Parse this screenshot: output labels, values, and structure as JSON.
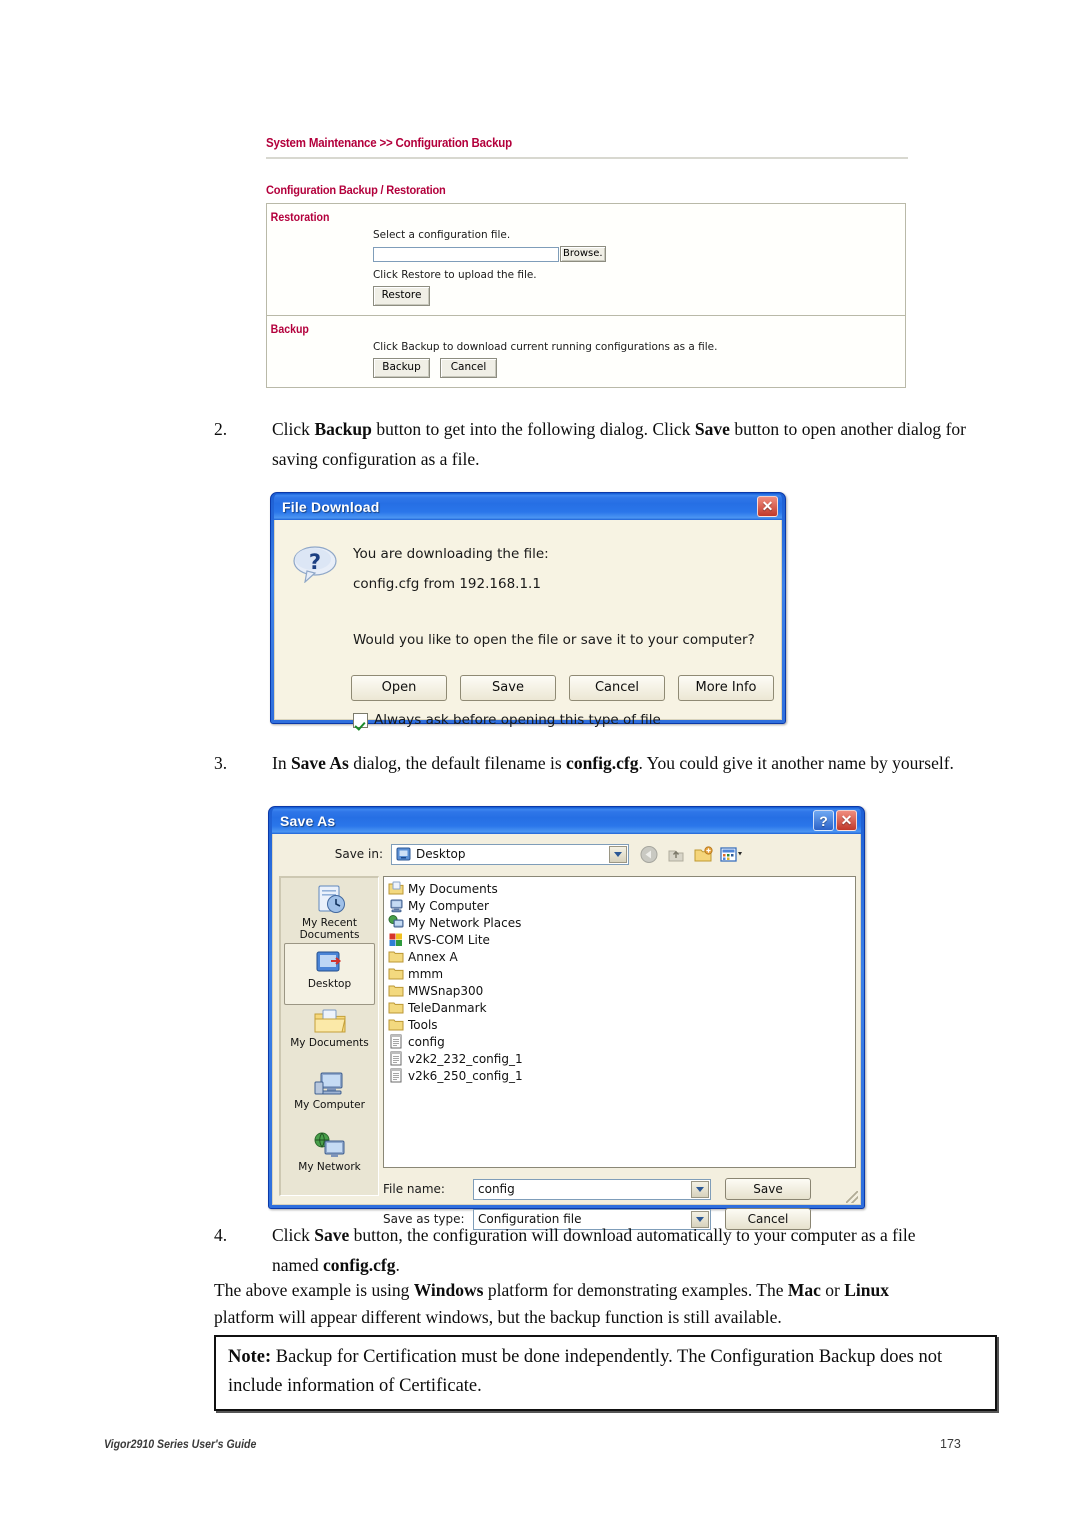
{
  "router_panel": {
    "breadcrumb": "System Maintenance >> Configuration Backup",
    "section_title": "Configuration Backup / Restoration",
    "restoration": {
      "label": "Restoration",
      "select_text": "Select a configuration file.",
      "file_input_value": "",
      "browse_label": "Browse.",
      "restore_hint": "Click Restore to upload the file.",
      "restore_label": "Restore"
    },
    "backup": {
      "label": "Backup",
      "hint": "Click Backup to download current running configurations as a file.",
      "backup_label": "Backup",
      "cancel_label": "Cancel"
    },
    "accent_color": "#b3003c"
  },
  "steps": {
    "step2": {
      "number": "2.",
      "text_parts": [
        {
          "t": "Click ",
          "b": false
        },
        {
          "t": "Backup",
          "b": true
        },
        {
          "t": " button to get into the following dialog. Click ",
          "b": false
        },
        {
          "t": "Save",
          "b": true
        },
        {
          "t": " button to open another dialog for saving configuration as a file.",
          "b": false
        }
      ]
    },
    "step3": {
      "number": "3.",
      "text_parts": [
        {
          "t": "In ",
          "b": false
        },
        {
          "t": "Save As",
          "b": true
        },
        {
          "t": " dialog, the default filename is ",
          "b": false
        },
        {
          "t": "config.cfg",
          "b": true
        },
        {
          "t": ". You could give it another name by yourself.",
          "b": false
        }
      ]
    },
    "step4": {
      "number": "4.",
      "text_parts": [
        {
          "t": "Click ",
          "b": false
        },
        {
          "t": "Save",
          "b": true
        },
        {
          "t": " button, the configuration will download automatically to your computer as a file named ",
          "b": false
        },
        {
          "t": "config.cfg",
          "b": true
        },
        {
          "t": ".",
          "b": false
        }
      ]
    }
  },
  "platform_note": {
    "text_parts": [
      {
        "t": "The above example is using ",
        "b": false
      },
      {
        "t": "Windows",
        "b": true
      },
      {
        "t": " platform for demonstrating examples. The ",
        "b": false
      },
      {
        "t": "Mac",
        "b": true
      },
      {
        "t": " or ",
        "b": false
      },
      {
        "t": "Linux",
        "b": true
      },
      {
        "t": " platform will appear different windows, but the backup function is still available.",
        "b": false
      }
    ]
  },
  "note_box": {
    "text_parts": [
      {
        "t": "Note:",
        "b": true
      },
      {
        "t": " Backup for Certification must be done independently. The Configuration Backup does not include information of Certificate.",
        "b": false
      }
    ]
  },
  "footer": {
    "left": "Vigor2910 Series User's Guide",
    "page": "173"
  },
  "file_download_dialog": {
    "title": "File Download",
    "close_label": "✕",
    "icon": "question-bubble-icon",
    "line1": "You are downloading the file:",
    "line2": "config.cfg from 192.168.1.1",
    "line3": "Would you like to open the file or save it to your computer?",
    "buttons": [
      "Open",
      "Save",
      "Cancel",
      "More Info"
    ],
    "checkbox_label": "Always ask before opening this type of file",
    "checkbox_checked": true
  },
  "save_as_dialog": {
    "title": "Save As",
    "help_label": "?",
    "close_label": "✕",
    "save_in_label": "Save in:",
    "save_in_value": "Desktop",
    "toolbar_icons": [
      "back-icon",
      "up-one-level-icon",
      "new-folder-icon",
      "views-icon"
    ],
    "places": [
      {
        "label": "My Recent\nDocuments",
        "icon": "recent-documents-icon",
        "selected": false
      },
      {
        "label": "Desktop",
        "icon": "desktop-icon",
        "selected": true
      },
      {
        "label": "My Documents",
        "icon": "my-documents-icon",
        "selected": false
      },
      {
        "label": "My Computer",
        "icon": "my-computer-icon",
        "selected": false
      },
      {
        "label": "My Network",
        "icon": "my-network-icon",
        "selected": false
      }
    ],
    "files": [
      {
        "name": "My Documents",
        "icon": "documents-folder-icon"
      },
      {
        "name": "My Computer",
        "icon": "my-computer-icon"
      },
      {
        "name": "My Network Places",
        "icon": "network-places-icon"
      },
      {
        "name": "RVS-COM Lite",
        "icon": "app-icon"
      },
      {
        "name": "Annex A",
        "icon": "folder-icon"
      },
      {
        "name": "mmm",
        "icon": "folder-icon"
      },
      {
        "name": "MWSnap300",
        "icon": "folder-icon"
      },
      {
        "name": "TeleDanmark",
        "icon": "folder-icon"
      },
      {
        "name": "Tools",
        "icon": "folder-icon"
      },
      {
        "name": "config",
        "icon": "file-icon"
      },
      {
        "name": "v2k2_232_config_1",
        "icon": "file-icon"
      },
      {
        "name": "v2k6_250_config_1",
        "icon": "file-icon"
      }
    ],
    "file_name_label": "File name:",
    "file_name_value": "config",
    "save_as_type_label": "Save as type:",
    "save_as_type_value": "Configuration file",
    "save_button": "Save",
    "cancel_button": "Cancel"
  }
}
